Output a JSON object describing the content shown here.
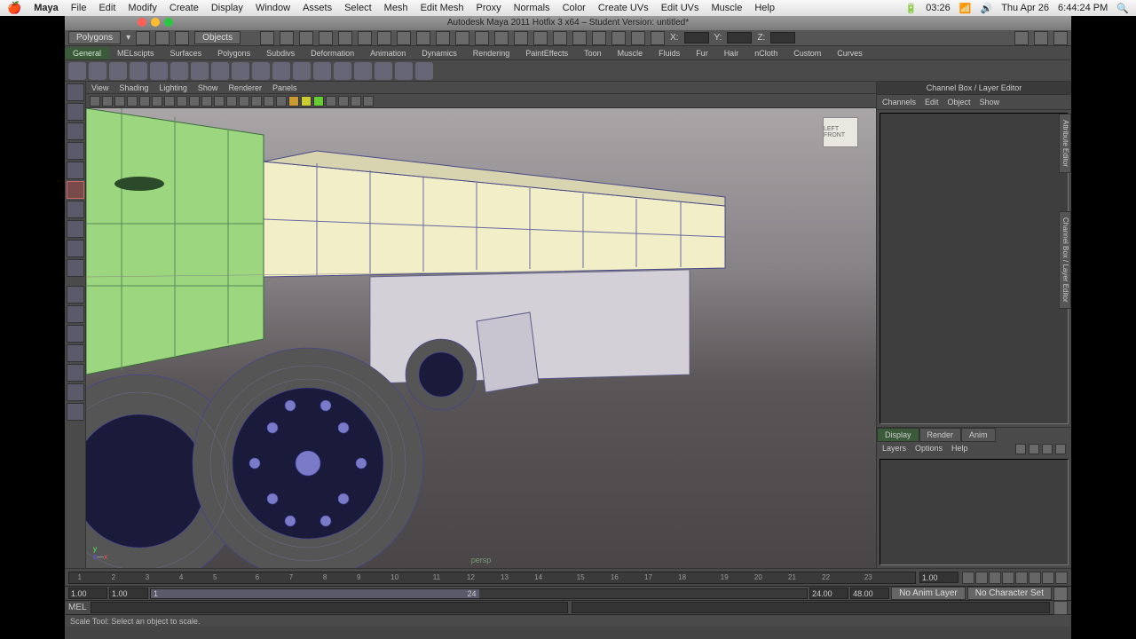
{
  "mac_menu": {
    "app": "Maya",
    "items": [
      "File",
      "Edit",
      "Modify",
      "Create",
      "Display",
      "Window",
      "Assets",
      "Select",
      "Mesh",
      "Edit Mesh",
      "Proxy",
      "Normals",
      "Color",
      "Create UVs",
      "Edit UVs",
      "Muscle",
      "Help"
    ],
    "right": {
      "battery": "03:26",
      "day": "Thu Apr 26",
      "time": "6:44:24 PM"
    }
  },
  "titlebar": "Autodesk Maya 2011 Hotfix 3 x64 – Student Version: untitled*",
  "mode_dropdown": "Polygons",
  "object_dropdown": "Objects",
  "shelf_tabs": [
    "General",
    "MELscipts",
    "Surfaces",
    "Polygons",
    "Subdivs",
    "Deformation",
    "Animation",
    "Dynamics",
    "Rendering",
    "PaintEffects",
    "Toon",
    "Muscle",
    "Fluids",
    "Fur",
    "Hair",
    "nCloth",
    "Custom",
    "Curves"
  ],
  "shelf_active": 0,
  "view_menu": [
    "View",
    "Shading",
    "Lighting",
    "Show",
    "Renderer",
    "Panels"
  ],
  "viewcube": "LEFT  FRONT",
  "persp": "persp",
  "right_panel": {
    "title": "Channel Box / Layer Editor",
    "tabs": [
      "Channels",
      "Edit",
      "Object",
      "Show"
    ],
    "layer_tabs": [
      "Display",
      "Render",
      "Anim"
    ],
    "layer_menu": [
      "Layers",
      "Options",
      "Help"
    ]
  },
  "side_tabs": [
    "Attribute Editor",
    "Channel Box / Layer Editor"
  ],
  "timeline": {
    "current": "1",
    "ticks": [
      "1",
      "2",
      "3",
      "4",
      "5",
      "6",
      "7",
      "8",
      "9",
      "10",
      "11",
      "12",
      "13",
      "14",
      "15",
      "16",
      "17",
      "18",
      "19",
      "20",
      "21",
      "22",
      "23"
    ],
    "range_start": "1.00",
    "range_start2": "1.00",
    "slider_start": "1",
    "slider_end": "24",
    "range_end": "24.00",
    "range_end2": "48.00",
    "anim_layer": "No Anim Layer",
    "char_set": "No Character Set",
    "frame_field": "1.00"
  },
  "cmd_label": "MEL",
  "status": "Scale Tool: Select an object to scale.",
  "xyz": {
    "x": "X:",
    "y": "Y:",
    "z": "Z:"
  }
}
